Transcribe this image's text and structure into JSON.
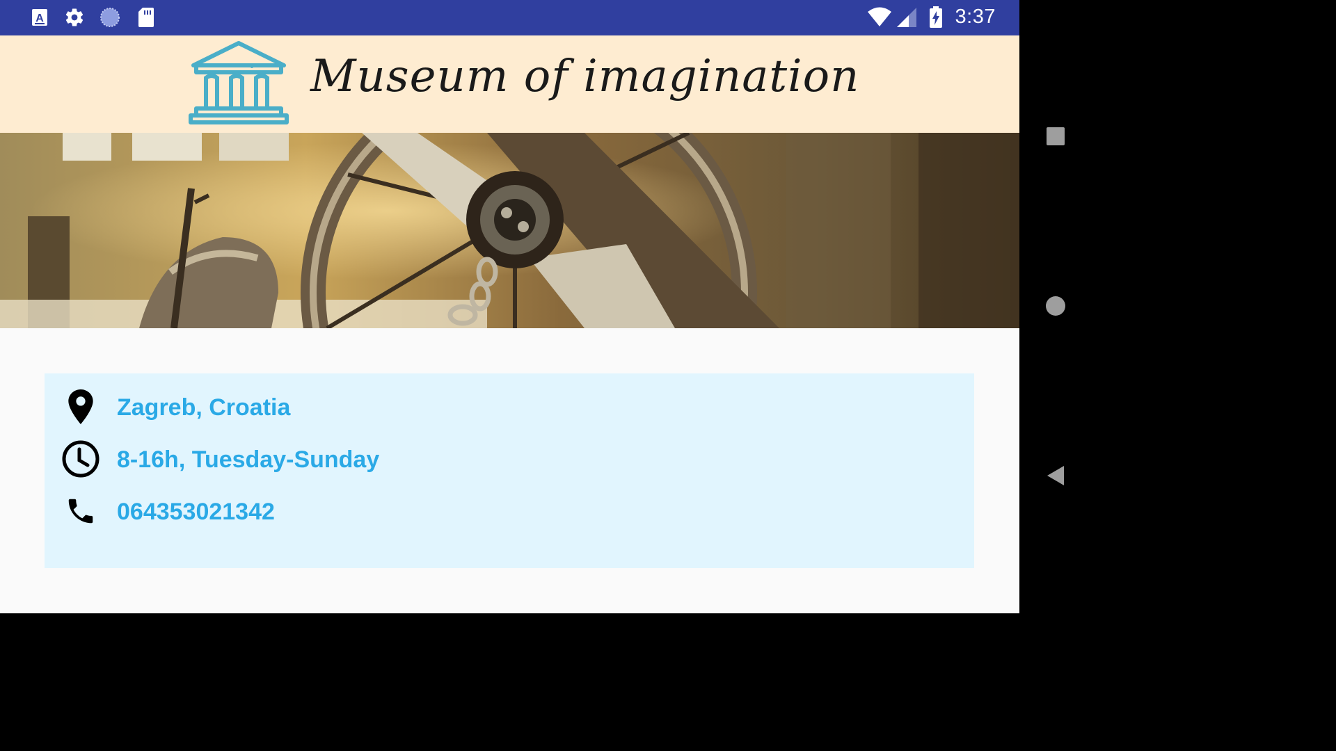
{
  "status_bar": {
    "time": "3:37",
    "icons": [
      "keyboard-a-icon",
      "settings-gear-icon",
      "sync-circle-icon",
      "sd-card-icon",
      "wifi-icon",
      "cell-signal-icon",
      "battery-charging-icon"
    ],
    "background": "#303f9f"
  },
  "header": {
    "title": "Museum of imagination",
    "logo": "museum-building-icon",
    "background": "#feecd1",
    "logo_color": "#4aaec8"
  },
  "hero": {
    "image": "rusty-wheel-photo"
  },
  "info": {
    "location": "Zagreb, Croatia",
    "hours": "8-16h, Tuesday-Sunday",
    "phone": "064353021342",
    "text_color": "#2aa9e6",
    "card_background": "#e1f5fe"
  },
  "nav_bar": {
    "buttons": [
      "recents",
      "home",
      "back"
    ]
  }
}
